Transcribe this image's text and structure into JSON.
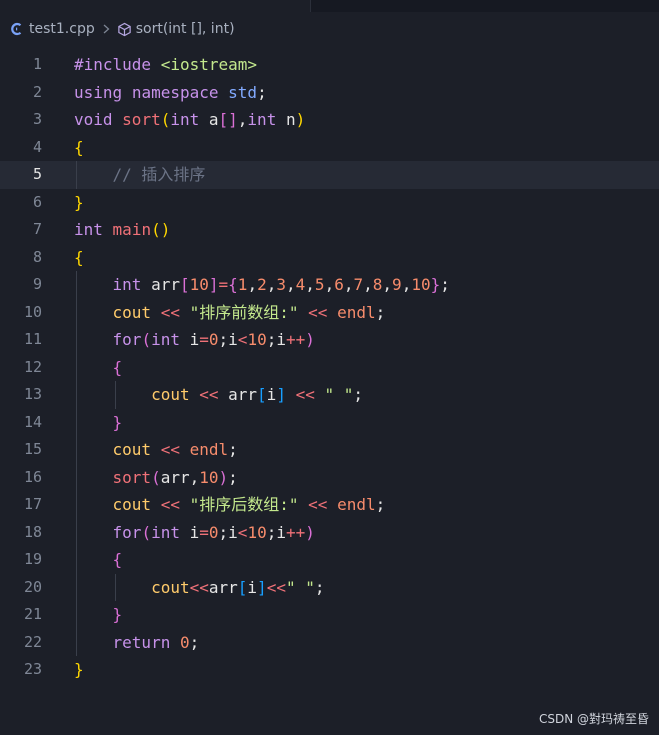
{
  "breadcrumb": {
    "file_name": "test1.cpp",
    "symbol": "sort(int [], int)",
    "file_icon": "cpp-file-icon",
    "symbol_icon": "cube-method-icon"
  },
  "editor": {
    "current_line": 5,
    "lines": [
      {
        "n": "1",
        "tokens": [
          [
            "pp",
            "#include"
          ],
          [
            "plain",
            " "
          ],
          [
            "inc",
            "<iostream>"
          ]
        ]
      },
      {
        "n": "2",
        "tokens": [
          [
            "kw",
            "using"
          ],
          [
            "plain",
            " "
          ],
          [
            "kw",
            "namespace"
          ],
          [
            "plain",
            " "
          ],
          [
            "std",
            "std"
          ],
          [
            "plain",
            ";"
          ]
        ]
      },
      {
        "n": "3",
        "tokens": [
          [
            "ty",
            "void"
          ],
          [
            "plain",
            " "
          ],
          [
            "fn",
            "sort"
          ],
          [
            "br1",
            "("
          ],
          [
            "ty",
            "int"
          ],
          [
            "plain",
            " a"
          ],
          [
            "br2",
            "[]"
          ],
          [
            "plain",
            ","
          ],
          [
            "ty",
            "int"
          ],
          [
            "plain",
            " n"
          ],
          [
            "br1",
            ")"
          ]
        ]
      },
      {
        "n": "4",
        "tokens": [
          [
            "br1",
            "{"
          ]
        ]
      },
      {
        "n": "5",
        "tokens": [
          [
            "plain",
            "    "
          ],
          [
            "cmt",
            "// 插入排序"
          ]
        ]
      },
      {
        "n": "6",
        "tokens": [
          [
            "br1",
            "}"
          ]
        ]
      },
      {
        "n": "7",
        "tokens": [
          [
            "ty",
            "int"
          ],
          [
            "plain",
            " "
          ],
          [
            "fn",
            "main"
          ],
          [
            "br1",
            "()"
          ]
        ]
      },
      {
        "n": "8",
        "tokens": [
          [
            "br1",
            "{"
          ]
        ]
      },
      {
        "n": "9",
        "tokens": [
          [
            "plain",
            "    "
          ],
          [
            "ty",
            "int"
          ],
          [
            "plain",
            " arr"
          ],
          [
            "br2",
            "["
          ],
          [
            "num",
            "10"
          ],
          [
            "br2",
            "]"
          ],
          [
            "op",
            "="
          ],
          [
            "br2",
            "{"
          ],
          [
            "num",
            "1"
          ],
          [
            "plain",
            ","
          ],
          [
            "num",
            "2"
          ],
          [
            "plain",
            ","
          ],
          [
            "num",
            "3"
          ],
          [
            "plain",
            ","
          ],
          [
            "num",
            "4"
          ],
          [
            "plain",
            ","
          ],
          [
            "num",
            "5"
          ],
          [
            "plain",
            ","
          ],
          [
            "num",
            "6"
          ],
          [
            "plain",
            ","
          ],
          [
            "num",
            "7"
          ],
          [
            "plain",
            ","
          ],
          [
            "num",
            "8"
          ],
          [
            "plain",
            ","
          ],
          [
            "num",
            "9"
          ],
          [
            "plain",
            ","
          ],
          [
            "num",
            "10"
          ],
          [
            "br2",
            "}"
          ],
          [
            "plain",
            ";"
          ]
        ]
      },
      {
        "n": "10",
        "tokens": [
          [
            "plain",
            "    "
          ],
          [
            "cout",
            "cout"
          ],
          [
            "plain",
            " "
          ],
          [
            "op",
            "<<"
          ],
          [
            "plain",
            " "
          ],
          [
            "str",
            "\"排序前数组:\""
          ],
          [
            "plain",
            " "
          ],
          [
            "op",
            "<<"
          ],
          [
            "plain",
            " "
          ],
          [
            "endl",
            "endl"
          ],
          [
            "plain",
            ";"
          ]
        ]
      },
      {
        "n": "11",
        "tokens": [
          [
            "plain",
            "    "
          ],
          [
            "kw",
            "for"
          ],
          [
            "br2",
            "("
          ],
          [
            "ty",
            "int"
          ],
          [
            "plain",
            " i"
          ],
          [
            "op",
            "="
          ],
          [
            "num",
            "0"
          ],
          [
            "plain",
            ";i"
          ],
          [
            "op",
            "<"
          ],
          [
            "num",
            "10"
          ],
          [
            "plain",
            ";i"
          ],
          [
            "op",
            "++"
          ],
          [
            "br2",
            ")"
          ]
        ]
      },
      {
        "n": "12",
        "tokens": [
          [
            "plain",
            "    "
          ],
          [
            "br2",
            "{"
          ]
        ]
      },
      {
        "n": "13",
        "tokens": [
          [
            "plain",
            "        "
          ],
          [
            "cout",
            "cout"
          ],
          [
            "plain",
            " "
          ],
          [
            "op",
            "<<"
          ],
          [
            "plain",
            " arr"
          ],
          [
            "br3",
            "["
          ],
          [
            "plain",
            "i"
          ],
          [
            "br3",
            "]"
          ],
          [
            "plain",
            " "
          ],
          [
            "op",
            "<<"
          ],
          [
            "plain",
            " "
          ],
          [
            "str",
            "\" \""
          ],
          [
            "plain",
            ";"
          ]
        ]
      },
      {
        "n": "14",
        "tokens": [
          [
            "plain",
            "    "
          ],
          [
            "br2",
            "}"
          ]
        ]
      },
      {
        "n": "15",
        "tokens": [
          [
            "plain",
            "    "
          ],
          [
            "cout",
            "cout"
          ],
          [
            "plain",
            " "
          ],
          [
            "op",
            "<<"
          ],
          [
            "plain",
            " "
          ],
          [
            "endl",
            "endl"
          ],
          [
            "plain",
            ";"
          ]
        ]
      },
      {
        "n": "16",
        "tokens": [
          [
            "plain",
            "    "
          ],
          [
            "fn",
            "sort"
          ],
          [
            "br2",
            "("
          ],
          [
            "plain",
            "arr,"
          ],
          [
            "num",
            "10"
          ],
          [
            "br2",
            ")"
          ],
          [
            "plain",
            ";"
          ]
        ]
      },
      {
        "n": "17",
        "tokens": [
          [
            "plain",
            "    "
          ],
          [
            "cout",
            "cout"
          ],
          [
            "plain",
            " "
          ],
          [
            "op",
            "<<"
          ],
          [
            "plain",
            " "
          ],
          [
            "str",
            "\"排序后数组:\""
          ],
          [
            "plain",
            " "
          ],
          [
            "op",
            "<<"
          ],
          [
            "plain",
            " "
          ],
          [
            "endl",
            "endl"
          ],
          [
            "plain",
            ";"
          ]
        ]
      },
      {
        "n": "18",
        "tokens": [
          [
            "plain",
            "    "
          ],
          [
            "kw",
            "for"
          ],
          [
            "br2",
            "("
          ],
          [
            "ty",
            "int"
          ],
          [
            "plain",
            " i"
          ],
          [
            "op",
            "="
          ],
          [
            "num",
            "0"
          ],
          [
            "plain",
            ";i"
          ],
          [
            "op",
            "<"
          ],
          [
            "num",
            "10"
          ],
          [
            "plain",
            ";i"
          ],
          [
            "op",
            "++"
          ],
          [
            "br2",
            ")"
          ]
        ]
      },
      {
        "n": "19",
        "tokens": [
          [
            "plain",
            "    "
          ],
          [
            "br2",
            "{"
          ]
        ]
      },
      {
        "n": "20",
        "tokens": [
          [
            "plain",
            "        "
          ],
          [
            "cout",
            "cout"
          ],
          [
            "op",
            "<<"
          ],
          [
            "plain",
            "arr"
          ],
          [
            "br3",
            "["
          ],
          [
            "plain",
            "i"
          ],
          [
            "br3",
            "]"
          ],
          [
            "op",
            "<<"
          ],
          [
            "str",
            "\" \""
          ],
          [
            "plain",
            ";"
          ]
        ]
      },
      {
        "n": "21",
        "tokens": [
          [
            "plain",
            "    "
          ],
          [
            "br2",
            "}"
          ]
        ]
      },
      {
        "n": "22",
        "tokens": [
          [
            "plain",
            "    "
          ],
          [
            "kw",
            "return"
          ],
          [
            "plain",
            " "
          ],
          [
            "num",
            "0"
          ],
          [
            "plain",
            ";"
          ]
        ]
      },
      {
        "n": "23",
        "tokens": [
          [
            "br1",
            "}"
          ]
        ]
      }
    ]
  },
  "watermark": "CSDN @對玛祷至昏",
  "colors": {
    "background": "#1c1f28",
    "current_line": "#262a35",
    "keyword": "#c792ea",
    "function": "#f07178",
    "number": "#f78c6c",
    "string": "#c3e88d",
    "comment": "#6b7386",
    "bracket_level1": "#ffd700",
    "bracket_level2": "#da70d6",
    "bracket_level3": "#179fff"
  }
}
